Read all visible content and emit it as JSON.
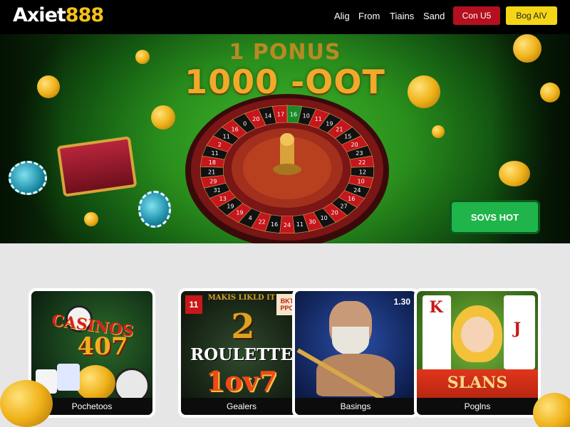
{
  "header": {
    "logo_white": "Axiet",
    "logo_gold": "888",
    "nav": [
      "Alig",
      "From",
      "Tiains",
      "Sand"
    ],
    "btn_red": "Con U5",
    "btn_yellow": "Bog AIV"
  },
  "hero": {
    "bonus_line": "1 PONUS",
    "amount_line": "1000 -OOT",
    "cta": "SOVS HOT",
    "wheel_numbers": [
      "16",
      "10",
      "11",
      "19",
      "21",
      "15",
      "20",
      "23",
      "22",
      "12",
      "10",
      "24",
      "16",
      "27",
      "20",
      "10",
      "30",
      "11",
      "24",
      "16",
      "22",
      "4",
      "19",
      "19",
      "13",
      "31",
      "29",
      "21",
      "18",
      "11",
      "2",
      "11",
      "16",
      "0",
      "20",
      "14",
      "17"
    ]
  },
  "cards": [
    {
      "label": "Pochetoos",
      "art_line1": "CASINOS",
      "art_line2": "407"
    },
    {
      "label": "Gealers",
      "art_line1": "ROULETTE",
      "art_line2": "1ov7",
      "art_top": "MAKIS LIKLD IT",
      "badge_left": "11",
      "badge_right": "BKT PPO",
      "art_big": "2"
    },
    {
      "label": "Basings",
      "badge_right": "1.30"
    },
    {
      "label": "Poglns",
      "art_line1": "SLANS",
      "card_k": "K",
      "card_j": "J"
    }
  ],
  "colors": {
    "brand_gold": "#f4c21a",
    "accent_red": "#b4101f",
    "accent_yellow": "#f5d616",
    "cta_green": "#1fb54a"
  }
}
